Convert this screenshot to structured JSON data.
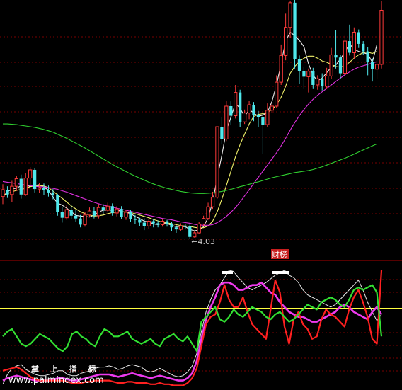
{
  "colors": {
    "background": "#000000",
    "grid": "#7a0000",
    "panel_divider": "#8a0000",
    "candle_up": "#ff3a3a",
    "candle_down": "#4fe8ec",
    "ma_white": "#f0f0f0",
    "ma_yellow": "#f2f26a",
    "ma_magenta": "#e030e0",
    "ma_green": "#30d030",
    "osc_white": "#e8e8e8",
    "osc_magenta": "#ee3aee",
    "osc_red": "#ff2020",
    "osc_green": "#32e032",
    "osc_yellow_level": "#ffff40",
    "marker": "#ffffff",
    "badge_bg": "#c81e1e"
  },
  "low_marker": {
    "text": "←4.03"
  },
  "badge": {
    "text": "财榜"
  },
  "watermark": {
    "line1": "掌 上 指 标",
    "line2": "www.palmindex.com"
  },
  "chart_data": [
    {
      "type": "candlestick",
      "title": "",
      "ylim": [
        3.6,
        11.0
      ],
      "lowest_price": 4.03,
      "candles": [
        [
          5.26,
          5.46,
          5.62,
          5.04
        ],
        [
          5.46,
          5.32,
          5.56,
          5.22
        ],
        [
          5.32,
          5.56,
          5.72,
          5.1
        ],
        [
          5.56,
          5.78,
          5.86,
          5.42
        ],
        [
          5.78,
          5.32,
          5.9,
          5.2
        ],
        [
          5.32,
          5.8,
          5.94,
          5.28
        ],
        [
          5.8,
          6.04,
          6.12,
          5.6
        ],
        [
          6.04,
          5.48,
          6.1,
          5.38
        ],
        [
          5.48,
          5.52,
          5.66,
          5.36
        ],
        [
          5.52,
          5.44,
          5.64,
          5.3
        ],
        [
          5.44,
          5.38,
          5.58,
          5.26
        ],
        [
          5.38,
          5.3,
          5.48,
          5.18
        ],
        [
          5.3,
          4.8,
          5.34,
          4.7
        ],
        [
          4.8,
          4.64,
          4.96,
          4.5
        ],
        [
          4.64,
          4.88,
          5.02,
          4.58
        ],
        [
          4.88,
          4.7,
          5.0,
          4.6
        ],
        [
          4.7,
          4.62,
          4.86,
          4.52
        ],
        [
          4.62,
          4.44,
          4.72,
          4.36
        ],
        [
          4.44,
          4.72,
          4.82,
          4.38
        ],
        [
          4.72,
          4.84,
          4.94,
          4.66
        ],
        [
          4.84,
          4.7,
          4.96,
          4.62
        ],
        [
          4.7,
          4.94,
          5.04,
          4.62
        ],
        [
          4.94,
          4.86,
          5.04,
          4.76
        ],
        [
          4.86,
          4.98,
          5.08,
          4.8
        ],
        [
          4.98,
          4.78,
          5.06,
          4.7
        ],
        [
          4.78,
          4.9,
          4.98,
          4.68
        ],
        [
          4.9,
          4.66,
          4.98,
          4.6
        ],
        [
          4.66,
          4.8,
          4.88,
          4.58
        ],
        [
          4.8,
          4.6,
          4.86,
          4.52
        ],
        [
          4.6,
          4.58,
          4.72,
          4.46
        ],
        [
          4.58,
          4.5,
          4.64,
          4.4
        ],
        [
          4.5,
          4.4,
          4.62,
          4.28
        ],
        [
          4.4,
          4.54,
          4.62,
          4.32
        ],
        [
          4.54,
          4.48,
          4.6,
          4.36
        ],
        [
          4.48,
          4.44,
          4.56,
          4.36
        ],
        [
          4.44,
          4.54,
          4.6,
          4.38
        ],
        [
          4.54,
          4.46,
          4.58,
          4.38
        ],
        [
          4.46,
          4.36,
          4.52,
          4.26
        ],
        [
          4.36,
          4.3,
          4.42,
          4.2
        ],
        [
          4.3,
          4.4,
          4.48,
          4.26
        ],
        [
          4.4,
          4.38,
          4.46,
          4.3
        ],
        [
          4.38,
          4.08,
          4.44,
          4.03
        ],
        [
          4.08,
          4.2,
          4.26,
          4.06
        ],
        [
          4.2,
          4.46,
          4.52,
          4.16
        ],
        [
          4.46,
          4.62,
          4.7,
          4.4
        ],
        [
          4.62,
          4.96,
          5.08,
          4.58
        ],
        [
          4.96,
          5.24,
          5.4,
          4.9
        ],
        [
          5.24,
          7.3,
          7.3,
          5.2
        ],
        [
          7.3,
          6.94,
          7.58,
          6.78
        ],
        [
          6.94,
          7.9,
          8.06,
          6.88
        ],
        [
          7.9,
          7.62,
          8.04,
          7.34
        ],
        [
          7.62,
          8.3,
          8.52,
          7.54
        ],
        [
          8.3,
          7.44,
          8.38,
          7.3
        ],
        [
          7.44,
          7.7,
          7.8,
          7.38
        ],
        [
          7.7,
          7.94,
          8.06,
          7.52
        ],
        [
          7.94,
          7.64,
          8.02,
          7.46
        ],
        [
          7.64,
          7.58,
          7.76,
          7.28
        ],
        [
          7.58,
          7.36,
          7.7,
          6.5
        ],
        [
          7.36,
          7.78,
          7.98,
          7.3
        ],
        [
          7.78,
          7.9,
          8.0,
          7.7
        ],
        [
          7.9,
          8.6,
          8.8,
          7.86
        ],
        [
          8.6,
          9.38,
          9.7,
          8.52
        ],
        [
          9.38,
          10.2,
          10.6,
          9.24
        ],
        [
          10.2,
          10.92,
          10.98,
          9.9
        ],
        [
          10.92,
          9.28,
          11.0,
          9.0
        ],
        [
          9.28,
          8.92,
          9.38,
          8.54
        ],
        [
          8.92,
          8.76,
          9.04,
          8.4
        ],
        [
          8.76,
          8.92,
          9.0,
          8.3
        ],
        [
          8.92,
          8.52,
          9.02,
          8.4
        ],
        [
          8.52,
          8.7,
          8.8,
          8.38
        ],
        [
          8.7,
          8.48,
          8.86,
          8.36
        ],
        [
          8.48,
          8.78,
          9.02,
          8.4
        ],
        [
          8.78,
          9.4,
          9.6,
          8.7
        ],
        [
          9.4,
          9.32,
          10.12,
          9.0
        ],
        [
          9.32,
          8.86,
          9.4,
          8.7
        ],
        [
          8.86,
          9.8,
          9.96,
          8.8
        ],
        [
          9.8,
          9.46,
          10.28,
          9.38
        ],
        [
          9.46,
          10.06,
          10.2,
          9.28
        ],
        [
          10.06,
          9.72,
          10.14,
          9.6
        ],
        [
          9.72,
          9.5,
          9.8,
          9.4
        ],
        [
          9.5,
          9.2,
          9.62,
          8.8
        ],
        [
          9.2,
          8.98,
          9.3,
          8.62
        ],
        [
          8.98,
          9.12,
          9.64,
          8.7
        ],
        [
          9.12,
          10.7,
          10.96,
          9.0
        ]
      ],
      "moving_averages": [
        {
          "color": "#f0f0f0",
          "values": [
            5.26,
            5.39,
            5.49,
            5.5,
            5.58,
            5.61,
            5.55,
            5.58,
            5.61,
            5.53,
            5.45,
            5.24,
            5.07,
            5.01,
            4.92,
            4.82,
            4.71,
            4.69,
            4.68,
            4.66,
            4.72,
            4.81,
            4.86,
            4.86,
            4.86,
            4.88,
            4.82,
            4.8,
            4.76,
            4.68,
            4.62,
            4.54,
            4.52,
            4.46,
            4.44,
            4.48,
            4.47,
            4.42,
            4.38,
            4.39,
            4.38,
            4.3,
            4.26,
            4.28,
            4.38,
            4.64,
            5.1,
            5.82,
            6.46,
            7.18,
            7.58,
            7.98,
            7.84,
            7.6,
            7.8,
            7.7,
            7.6,
            7.64,
            7.72,
            8.04,
            8.52,
            9.14,
            9.8,
            10.06,
            9.96,
            9.82,
            9.64,
            9.14,
            8.8,
            8.64,
            8.72,
            8.88,
            9.04,
            9.1,
            9.28,
            9.48,
            9.72,
            9.56,
            9.5,
            9.46,
            9.42,
            9.18,
            9.7
          ]
        },
        {
          "color": "#f2f26a",
          "values": [
            5.3,
            5.34,
            5.4,
            5.44,
            5.47,
            5.5,
            5.55,
            5.57,
            5.58,
            5.57,
            5.52,
            5.42,
            5.31,
            5.21,
            5.1,
            4.99,
            4.9,
            4.82,
            4.76,
            4.72,
            4.69,
            4.7,
            4.72,
            4.76,
            4.79,
            4.81,
            4.82,
            4.81,
            4.79,
            4.76,
            4.72,
            4.68,
            4.64,
            4.59,
            4.55,
            4.51,
            4.49,
            4.47,
            4.44,
            4.41,
            4.4,
            4.39,
            4.36,
            4.34,
            4.35,
            4.4,
            4.54,
            4.82,
            5.18,
            5.58,
            6.0,
            6.42,
            6.78,
            7.08,
            7.38,
            7.6,
            7.66,
            7.68,
            7.72,
            7.8,
            7.94,
            8.16,
            8.48,
            8.86,
            9.06,
            9.2,
            9.3,
            9.36,
            9.36,
            9.3,
            9.22,
            9.18,
            9.12,
            9.06,
            9.04,
            9.08,
            9.18,
            9.3,
            9.4,
            9.46,
            9.48,
            9.44,
            9.5
          ]
        },
        {
          "color": "#e030e0",
          "values": [
            5.7,
            5.68,
            5.66,
            5.64,
            5.62,
            5.6,
            5.58,
            5.56,
            5.55,
            5.54,
            5.52,
            5.5,
            5.47,
            5.43,
            5.39,
            5.34,
            5.29,
            5.24,
            5.19,
            5.14,
            5.09,
            5.05,
            5.01,
            4.98,
            4.95,
            4.92,
            4.89,
            4.86,
            4.83,
            4.8,
            4.77,
            4.74,
            4.71,
            4.68,
            4.65,
            4.62,
            4.6,
            4.58,
            4.55,
            4.52,
            4.5,
            4.48,
            4.45,
            4.43,
            4.42,
            4.42,
            4.44,
            4.5,
            4.58,
            4.68,
            4.8,
            4.94,
            5.1,
            5.28,
            5.46,
            5.64,
            5.82,
            6.0,
            6.18,
            6.36,
            6.54,
            6.74,
            6.96,
            7.2,
            7.42,
            7.62,
            7.8,
            7.96,
            8.1,
            8.22,
            8.32,
            8.42,
            8.52,
            8.62,
            8.72,
            8.82,
            8.9,
            8.98,
            9.04,
            9.08,
            9.12,
            9.16,
            9.2
          ]
        },
        {
          "color": "#30d030",
          "values": [
            7.38,
            7.38,
            7.37,
            7.36,
            7.34,
            7.32,
            7.3,
            7.28,
            7.25,
            7.22,
            7.18,
            7.14,
            7.08,
            7.02,
            6.96,
            6.89,
            6.82,
            6.75,
            6.68,
            6.6,
            6.52,
            6.44,
            6.36,
            6.28,
            6.2,
            6.13,
            6.06,
            5.99,
            5.92,
            5.86,
            5.8,
            5.74,
            5.68,
            5.63,
            5.58,
            5.54,
            5.5,
            5.47,
            5.44,
            5.41,
            5.39,
            5.37,
            5.36,
            5.35,
            5.35,
            5.36,
            5.37,
            5.39,
            5.41,
            5.44,
            5.47,
            5.51,
            5.55,
            5.58,
            5.62,
            5.66,
            5.69,
            5.73,
            5.77,
            5.81,
            5.84,
            5.87,
            5.9,
            5.93,
            5.96,
            5.98,
            6.0,
            6.02,
            6.05,
            6.09,
            6.13,
            6.18,
            6.23,
            6.28,
            6.33,
            6.38,
            6.44,
            6.5,
            6.56,
            6.62,
            6.68,
            6.74,
            6.8
          ]
        }
      ]
    },
    {
      "type": "line",
      "title": "",
      "ylim": [
        0,
        100
      ],
      "levels": [
        {
          "color": "#ffff40",
          "value": 65
        }
      ],
      "series": [
        {
          "color": "#e8e8e8",
          "values": [
            3,
            11,
            16,
            18,
            19,
            15,
            13,
            11,
            10,
            10,
            11,
            12,
            14,
            14,
            11,
            10,
            10,
            12,
            13,
            14,
            16,
            17,
            17,
            18,
            17,
            15,
            16,
            18,
            19,
            18,
            17,
            14,
            13,
            14,
            16,
            14,
            12,
            10,
            9,
            10,
            13,
            18,
            28,
            46,
            62,
            72,
            80,
            84,
            90,
            96,
            95,
            90,
            86,
            82,
            80,
            82,
            84,
            86,
            89,
            92,
            94,
            96,
            92,
            90,
            86,
            80,
            76,
            74,
            72,
            70,
            68,
            66,
            68,
            72,
            76,
            80,
            84,
            88,
            80,
            70,
            62,
            55,
            60
          ]
        },
        {
          "color": "#ee3aee",
          "values": [
            6,
            8,
            9,
            10,
            9,
            8,
            7,
            6,
            6,
            6,
            6,
            7,
            8,
            8,
            7,
            6,
            6,
            7,
            8,
            9,
            10,
            11,
            11,
            11,
            10,
            9,
            10,
            11,
            12,
            11,
            10,
            9,
            8,
            9,
            10,
            9,
            8,
            7,
            6,
            6,
            8,
            12,
            22,
            40,
            56,
            66,
            74,
            84,
            86,
            86,
            84,
            80,
            80,
            82,
            84,
            84,
            86,
            82,
            78,
            76,
            70,
            66,
            62,
            60,
            58,
            58,
            56,
            54,
            54,
            56,
            58,
            60,
            62,
            66,
            68,
            66,
            62,
            60,
            58,
            56,
            62,
            66,
            60
          ]
        },
        {
          "color": "#ff2020",
          "values": [
            14,
            15,
            16,
            17,
            15,
            12,
            9,
            7,
            6,
            6,
            6,
            6,
            6,
            6,
            5,
            4,
            4,
            4,
            5,
            5,
            6,
            6,
            6,
            6,
            5,
            4,
            4,
            5,
            5,
            4,
            4,
            4,
            3,
            3,
            4,
            3,
            3,
            2,
            2,
            2,
            4,
            8,
            16,
            34,
            52,
            58,
            60,
            70,
            84,
            72,
            66,
            66,
            74,
            62,
            52,
            48,
            44,
            40,
            64,
            88,
            78,
            50,
            36,
            56,
            62,
            52,
            48,
            40,
            42,
            56,
            64,
            60,
            58,
            54,
            50,
            64,
            74,
            80,
            70,
            58,
            40,
            36,
            96
          ]
        },
        {
          "color": "#32e032",
          "values": [
            42,
            46,
            48,
            42,
            36,
            34,
            36,
            40,
            44,
            42,
            40,
            36,
            32,
            30,
            34,
            44,
            46,
            42,
            40,
            36,
            34,
            42,
            48,
            46,
            42,
            42,
            44,
            46,
            40,
            38,
            36,
            38,
            40,
            36,
            34,
            40,
            42,
            44,
            40,
            38,
            42,
            36,
            30,
            54,
            58,
            62,
            66,
            56,
            54,
            58,
            64,
            60,
            58,
            62,
            66,
            64,
            62,
            58,
            56,
            60,
            62,
            58,
            54,
            56,
            60,
            64,
            68,
            66,
            64,
            70,
            72,
            74,
            72,
            68,
            66,
            72,
            80,
            82,
            80,
            82,
            84,
            78,
            42
          ]
        }
      ],
      "signal_marks": [
        2
      ]
    }
  ]
}
